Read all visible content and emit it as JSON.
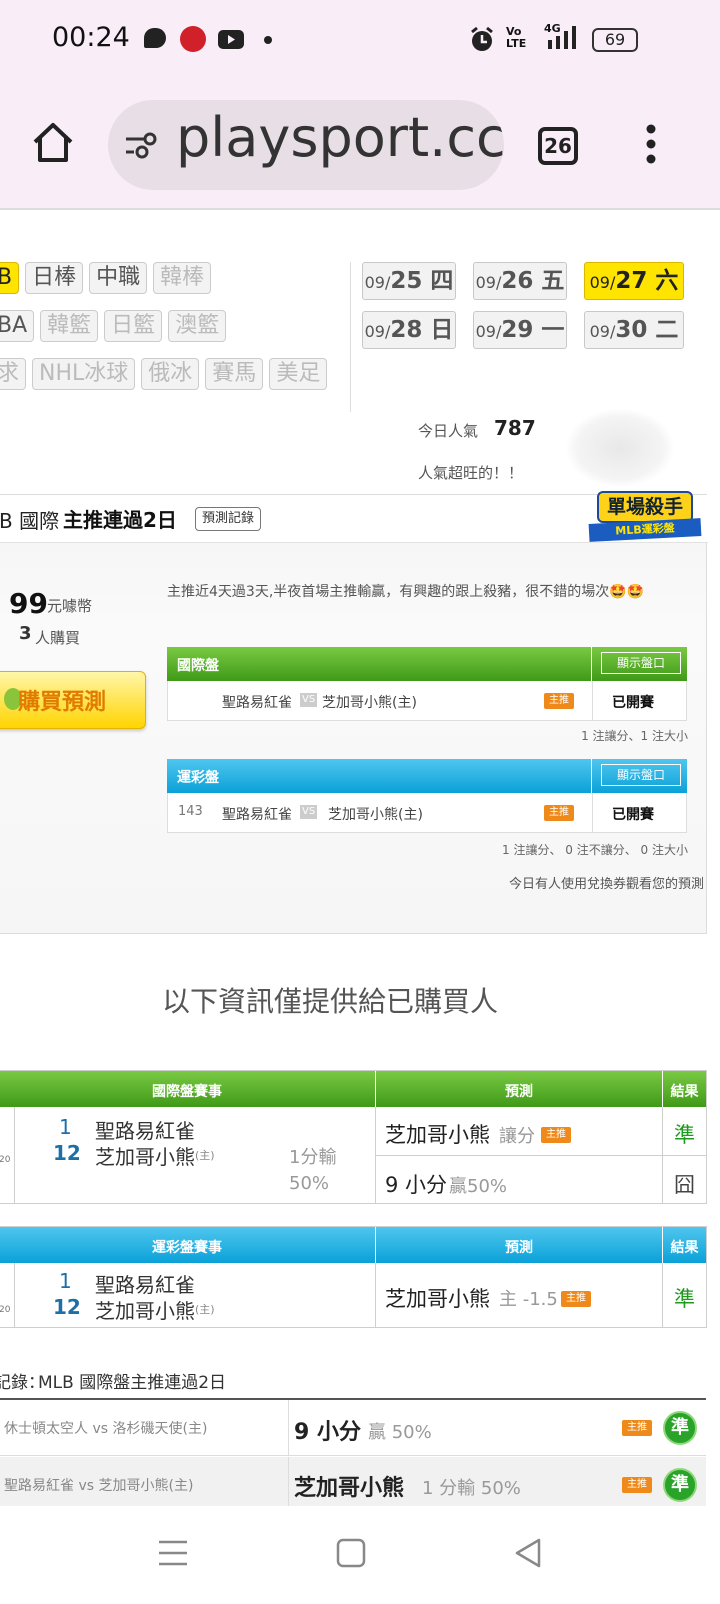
{
  "status_bar": {
    "time": "00:24",
    "network": "4G",
    "volte": "Vo LTE",
    "battery": "69"
  },
  "browser": {
    "url": "playsport.cc",
    "tab_count": "26"
  },
  "leagues": {
    "row1": [
      "B",
      "日棒",
      "中職",
      "韓棒"
    ],
    "row2": [
      "BA",
      "韓籃",
      "日籃",
      "澳籃"
    ],
    "row3": [
      "求",
      "NHL冰球",
      "俄冰",
      "賽馬",
      "美足"
    ]
  },
  "dates": [
    {
      "month": "09/",
      "day": "25 四"
    },
    {
      "month": "09/",
      "day": "26 五"
    },
    {
      "month": "09/",
      "day": "27 六"
    },
    {
      "month": "09/",
      "day": "28 日"
    },
    {
      "month": "09/",
      "day": "29 一"
    },
    {
      "month": "09/",
      "day": "30 二"
    }
  ],
  "popularity": {
    "label": "今日人氣",
    "count": "787",
    "note": "人氣超旺的！！"
  },
  "prediction": {
    "heading_prefix": "B 國際",
    "heading_bold": "主推連過2日",
    "record_button": "預測記錄",
    "badge_title": "單場殺手",
    "badge_sub": "MLB運彩盤",
    "price": "99",
    "price_unit": "元噱幣",
    "buyers": "3",
    "buyers_unit": "人購買",
    "buy_button": "購買預測",
    "comment": "主推近4天過3天,半夜首場主推輸贏，有興趣的跟上殺豬，很不錯的場次🤩🤩",
    "intl": {
      "title": "國際盤",
      "show": "顯示盤口",
      "num": "",
      "away": "聖路易紅雀",
      "vs": "VS",
      "home": "芝加哥小熊(主)",
      "tag": "主推",
      "status": "已開賽",
      "summary": "1 注讓分、1 注大小"
    },
    "lottery": {
      "title": "運彩盤",
      "show": "顯示盤口",
      "num": "143",
      "away": "聖路易紅雀",
      "vs": "VS",
      "home": "芝加哥小熊(主)",
      "tag": "主推",
      "status": "已開賽",
      "summary": "1 注讓分、 0 注不讓分、 0 注大小"
    },
    "coupon_note": "今日有人使用兌換券觀看您的預測"
  },
  "info_notice": "以下資訊僅提供給已購買人",
  "intl_table": {
    "header_game": "國際盤賽事",
    "header_pred": "預測",
    "header_result": "結果",
    "clipped_time": "20",
    "away_score": "1",
    "away_team": "聖路易紅雀",
    "home_score": "12",
    "home_team": "芝加哥小熊",
    "home_mark": "(主)",
    "outcome": "1分輸 50%",
    "pred1_team": "芝加哥小熊",
    "pred1_type": "讓分",
    "pred1_tag": "主推",
    "pred1_result": "準",
    "pred2_text": "9 小分",
    "pred2_detail": "贏50%",
    "pred2_result": "囧"
  },
  "lottery_table": {
    "header_game": "運彩盤賽事",
    "header_pred": "預測",
    "header_result": "結果",
    "clipped_time": "20",
    "away_score": "1",
    "away_team": "聖路易紅雀",
    "home_score": "12",
    "home_team": "芝加哥小熊",
    "home_mark": "(主)",
    "pred_team": "芝加哥小熊",
    "pred_line": "主 -1.5",
    "pred_tag": "主推",
    "pred_result": "準"
  },
  "history": {
    "title_prefix": "記錄：",
    "title": "MLB 國際盤主推連過2日",
    "rows": [
      {
        "game": "休士頓太空人 vs 洛杉磯天使(主)",
        "pick": "9 小分",
        "detail": "贏 50%",
        "tag": "主推",
        "result": "準"
      },
      {
        "game": "聖路易紅雀 vs 芝加哥小熊(主)",
        "pick": "芝加哥小熊",
        "detail": "1 分輸 50%",
        "tag": "主推",
        "result": "準"
      }
    ]
  },
  "colors": {
    "accent_yellow": "#ffe400",
    "green": "#4aaa1c",
    "blue": "#10a8dd",
    "win": "#1e9a1e"
  }
}
